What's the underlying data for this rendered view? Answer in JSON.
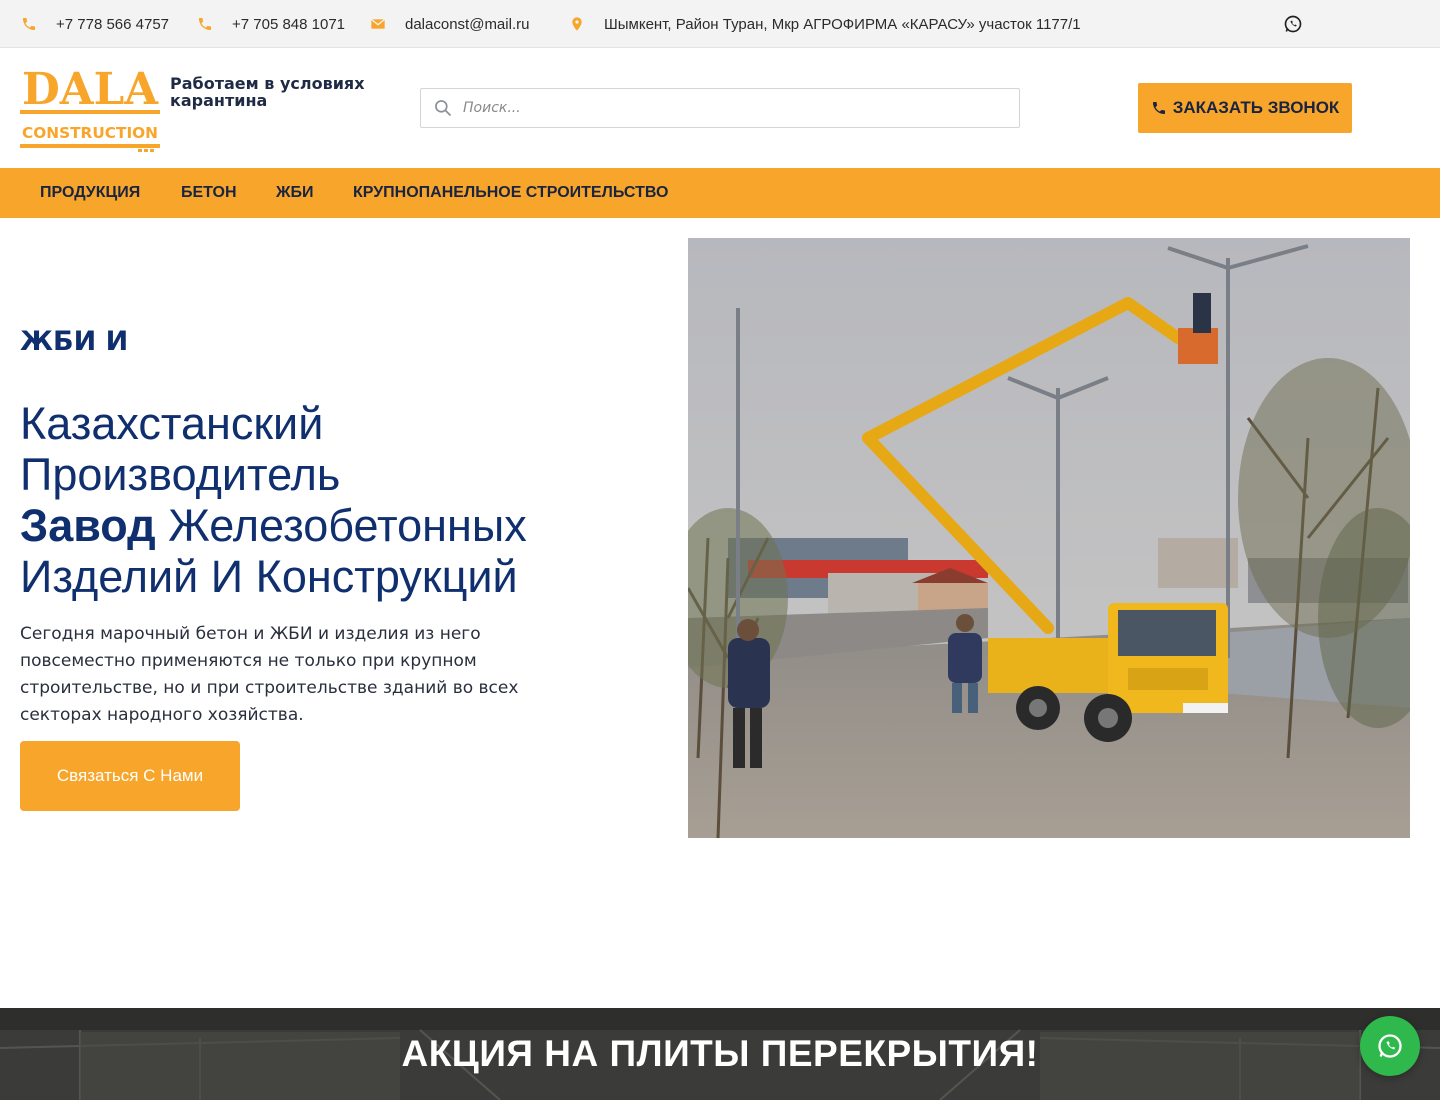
{
  "topbar": {
    "phone1": "+7 778 566 4757",
    "phone2": "+7 705 848 1071",
    "email": "dalaconst@mail.ru",
    "address": "Шымкент, Район Туран, Мкр АГРОФИРМА «КАРАСУ» участок 1177/1",
    "icons": [
      "phone-icon",
      "phone-icon",
      "envelope-icon",
      "map-pin-icon",
      "whatsapp-icon"
    ]
  },
  "header": {
    "logo_text_main": "DALA",
    "logo_text_sub": "CONSTRUCTION",
    "notice": "Работаем в условиях карантина",
    "search_placeholder": "Поиск...",
    "call_button": "ЗАКАЗАТЬ ЗВОНОК"
  },
  "nav": {
    "items": [
      "ПРОДУКЦИЯ",
      "БЕТОН",
      "ЖБИ",
      "КРУПНОПАНЕЛЬНОЕ СТРОИТЕЛЬСТВО"
    ]
  },
  "hero": {
    "tag": "ЖБИ И",
    "title_line1": "Казахстанский",
    "title_line2": "Производитель",
    "title_bold": "Завод",
    "title_line3_rest": " Железобетонных",
    "title_line4": "Изделий И Конструкций",
    "description": "Сегодня марочный бетон и ЖБИ и изделия из него повсеместно применяются не только при крупном строительстве, но и при строительстве зданий во всех секторах народного хозяйства.",
    "button": "Связаться С Нами"
  },
  "promo": {
    "title": "АКЦИЯ НА ПЛИТЫ ПЕРЕКРЫТИЯ!"
  },
  "colors": {
    "accent": "#f7a52b",
    "navy": "#0f2f6f",
    "whatsapp": "#2fb84b"
  }
}
